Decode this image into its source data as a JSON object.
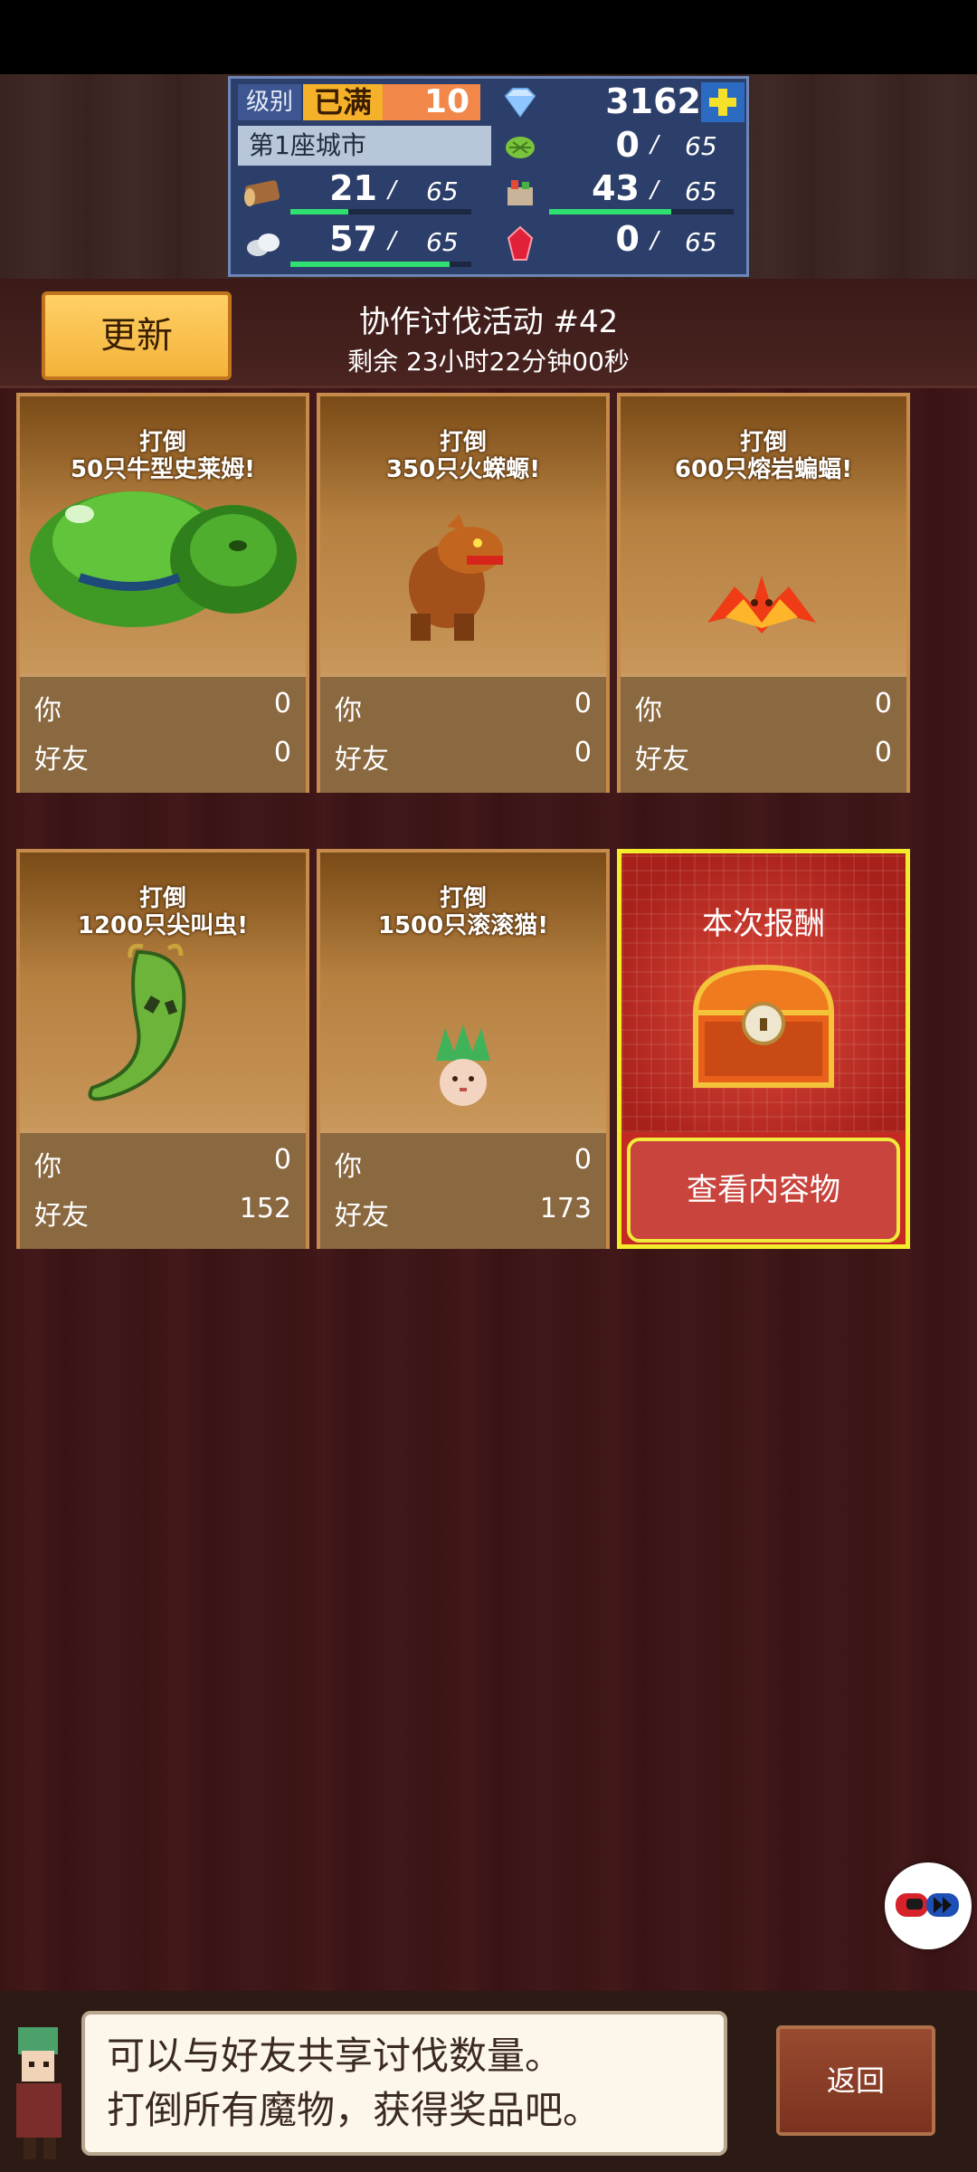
{
  "hud": {
    "level_label": "级别",
    "level_max": "已满",
    "level": "10",
    "gems": "3162",
    "city": "第1座城市",
    "resources": [
      {
        "icon": "grass-icon",
        "value": "0",
        "max": "65",
        "fill": 0.0
      },
      {
        "icon": "wood-log-icon",
        "value": "21",
        "max": "65",
        "fill": 0.32
      },
      {
        "icon": "food-icon",
        "value": "43",
        "max": "65",
        "fill": 0.66
      },
      {
        "icon": "stone-icon",
        "value": "57",
        "max": "65",
        "fill": 0.88
      },
      {
        "icon": "red-gem-icon",
        "value": "0",
        "max": "65",
        "fill": 0.0
      }
    ],
    "slash": "/"
  },
  "header": {
    "refresh_label": "更新",
    "event_title": "协作讨伐活动 #42",
    "event_timer": "剩余 23小时22分钟00秒"
  },
  "cards": [
    {
      "quest_line1": "打倒",
      "quest_line2": "50只牛型史莱姆!",
      "you_label": "你",
      "you": "0",
      "friend_label": "好友",
      "friend": "0",
      "monster": "slime-monster"
    },
    {
      "quest_line1": "打倒",
      "quest_line2": "350只火蝾螈!",
      "you_label": "你",
      "you": "0",
      "friend_label": "好友",
      "friend": "0",
      "monster": "fire-salamander"
    },
    {
      "quest_line1": "打倒",
      "quest_line2": "600只熔岩蝙蝠!",
      "you_label": "你",
      "you": "0",
      "friend_label": "好友",
      "friend": "0",
      "monster": "lava-bat"
    },
    {
      "quest_line1": "打倒",
      "quest_line2": "1200只尖叫虫!",
      "you_label": "你",
      "you": "0",
      "friend_label": "好友",
      "friend": "152",
      "monster": "screaming-worm"
    },
    {
      "quest_line1": "打倒",
      "quest_line2": "1500只滚滚猫!",
      "you_label": "你",
      "you": "0",
      "friend_label": "好友",
      "friend": "173",
      "monster": "rolling-cat"
    }
  ],
  "reward": {
    "label": "本次报酬",
    "button": "查看内容物"
  },
  "footer": {
    "speech_line1": "可以与好友共享讨伐数量。",
    "speech_line2": "打倒所有魔物，获得奖品吧。",
    "back_label": "返回"
  },
  "colors": {
    "accent_gold": "#f4b33a",
    "reward_red": "#c42a22",
    "progress_green": "#2ee06f"
  }
}
